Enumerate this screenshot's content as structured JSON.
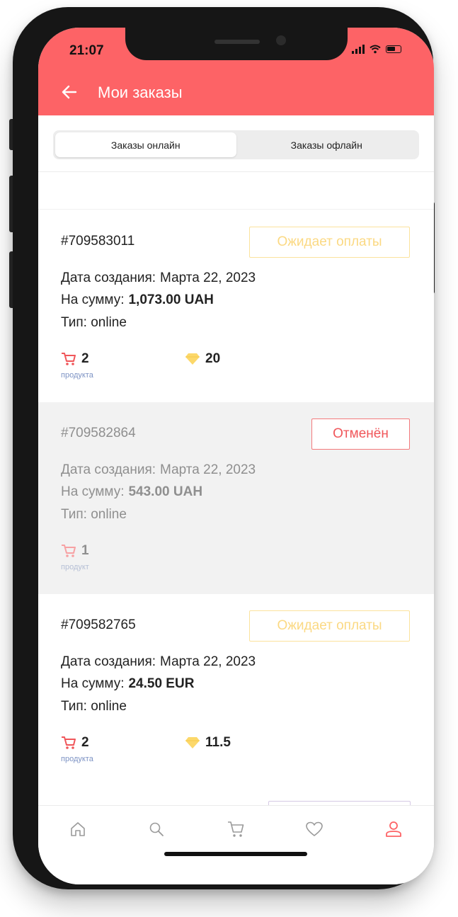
{
  "status_bar": {
    "time": "21:07"
  },
  "header": {
    "title": "Мои заказы"
  },
  "tabs": [
    {
      "label": "Заказы онлайн",
      "active": true
    },
    {
      "label": "Заказы офлайн",
      "active": false
    }
  ],
  "orders": [
    {
      "number": "#709583011",
      "status": "Ожидает оплаты",
      "created_label": "Дата создания:",
      "created_value": "Марта 22, 2023",
      "sum_label": "На сумму:",
      "sum_value": "1,073.00 UAH",
      "type_text": "Тип: online",
      "products_count": "2",
      "products_word": "продукта",
      "bonus": "20"
    },
    {
      "number": "#709582864",
      "status": "Отменён",
      "created_label": "Дата создания:",
      "created_value": "Марта 22, 2023",
      "sum_label": "На сумму:",
      "sum_value": "543.00 UAH",
      "type_text": "Тип: online",
      "products_count": "1",
      "products_word": "продукт"
    },
    {
      "number": "#709582765",
      "status": "Ожидает оплаты",
      "created_label": "Дата создания:",
      "created_value": "Марта 22, 2023",
      "sum_label": "На сумму:",
      "sum_value": "24.50 EUR",
      "type_text": "Тип: online",
      "products_count": "2",
      "products_word": "продукта",
      "bonus": "11.5"
    }
  ],
  "bottom_nav": {
    "items": [
      "home-icon",
      "search-icon",
      "cart-icon",
      "heart-icon",
      "profile-icon"
    ],
    "active": "profile-icon"
  },
  "colors": {
    "accent": "#fd6366",
    "pending": "#fbd983",
    "cancelled": "#f0565a",
    "gem": "#fcd86a"
  }
}
